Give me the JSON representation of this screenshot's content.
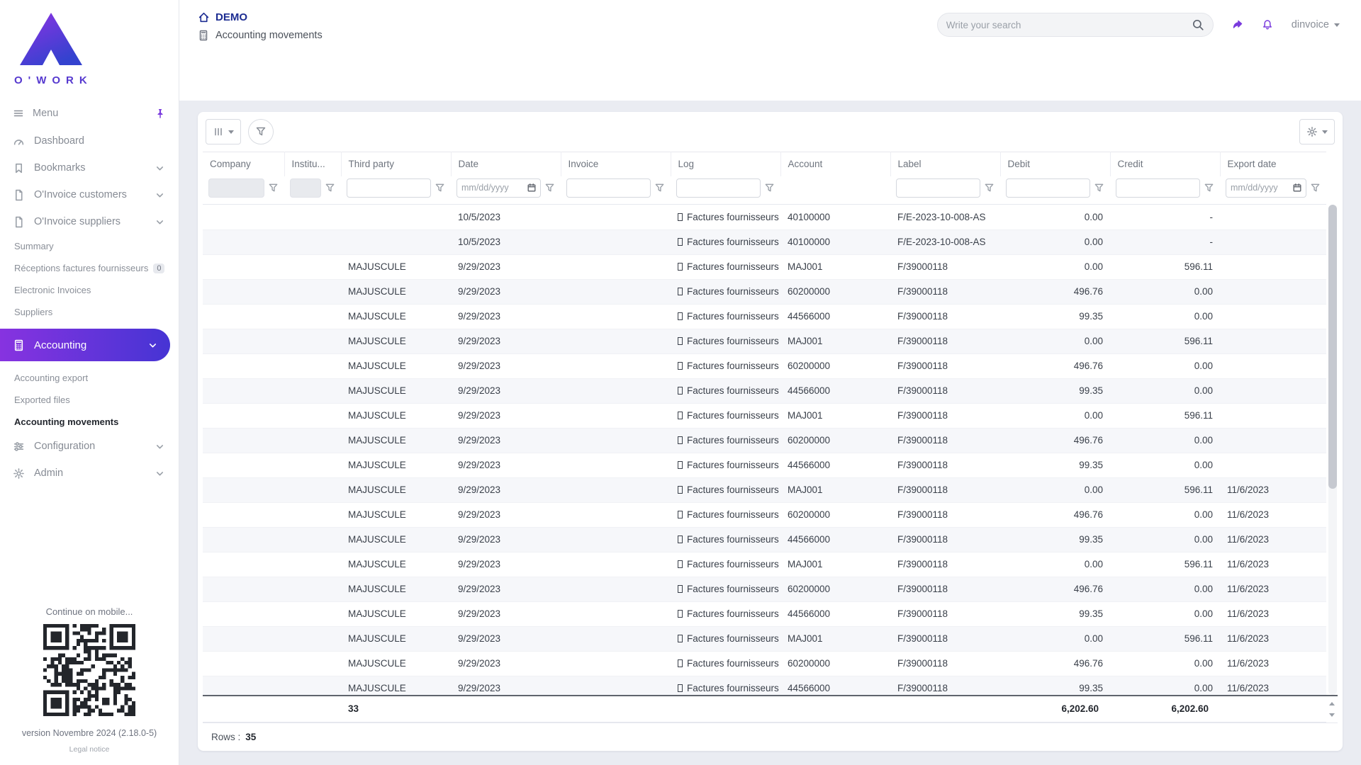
{
  "brand": {
    "wordmark": "O'WORK",
    "mobile_hint": "Continue on mobile...",
    "version": "version Novembre 2024 (2.18.0-5)",
    "legal_notice": "Legal notice"
  },
  "colors": {
    "accent_gradient_from": "#8733e0",
    "accent_gradient_to": "#4634d4",
    "brand_navy": "#1d2d92",
    "icon_purple": "#7a3bdd"
  },
  "icons": {
    "menu": "hamburger",
    "pin": "pushpin",
    "dashboard": "gauge",
    "bookmarks": "bookmark",
    "invoice": "file-document",
    "accounting": "calculator",
    "configuration": "sliders",
    "admin": "gear",
    "home": "house",
    "search": "magnifier",
    "share": "forward-arrow",
    "notifications": "bell",
    "filter": "funnel",
    "date": "calendar",
    "columns": "triple-bar",
    "settings": "gear",
    "log_prefix": "missing-glyph-box"
  },
  "header": {
    "env_label": "DEMO",
    "page_title": "Accounting movements",
    "search": {
      "placeholder": "Write your search"
    },
    "user_menu": {
      "label": "dinvoice"
    }
  },
  "sidebar": {
    "menu_label": "Menu",
    "items": {
      "dashboard": "Dashboard",
      "bookmarks": "Bookmarks",
      "oinvoice_customers": "O'Invoice customers",
      "oinvoice_suppliers": "O'Invoice suppliers",
      "summary": "Summary",
      "receptions": "Réceptions factures fournisseurs",
      "receptions_badge": "0",
      "electronic_invoices": "Electronic Invoices",
      "suppliers": "Suppliers",
      "accounting": "Accounting",
      "accounting_export": "Accounting export",
      "exported_files": "Exported files",
      "accounting_movements": "Accounting movements",
      "configuration": "Configuration",
      "admin": "Admin"
    }
  },
  "table": {
    "columns": [
      "Company",
      "Institu...",
      "Third party",
      "Date",
      "Invoice",
      "Log",
      "Account",
      "Label",
      "Debit",
      "Credit",
      "Export date"
    ],
    "filters": {
      "date_placeholder": "mm/dd/yyyy",
      "export_placeholder": "mm/dd/yyyy"
    },
    "rows": [
      {
        "company": "",
        "institution": "",
        "third_party": "",
        "date": "10/5/2023",
        "invoice": "",
        "log": "Factures fournisseurs",
        "account": "40100000",
        "label": "F/E-2023-10-008-AS",
        "debit": "0.00",
        "credit": "-",
        "export_date": ""
      },
      {
        "company": "",
        "institution": "",
        "third_party": "",
        "date": "10/5/2023",
        "invoice": "",
        "log": "Factures fournisseurs",
        "account": "40100000",
        "label": "F/E-2023-10-008-AS",
        "debit": "0.00",
        "credit": "-",
        "export_date": ""
      },
      {
        "company": "",
        "institution": "",
        "third_party": "MAJUSCULE",
        "date": "9/29/2023",
        "invoice": "",
        "log": "Factures fournisseurs",
        "account": "MAJ001",
        "label": "F/39000118",
        "debit": "0.00",
        "credit": "596.11",
        "export_date": ""
      },
      {
        "company": "",
        "institution": "",
        "third_party": "MAJUSCULE",
        "date": "9/29/2023",
        "invoice": "",
        "log": "Factures fournisseurs",
        "account": "60200000",
        "label": "F/39000118",
        "debit": "496.76",
        "credit": "0.00",
        "export_date": ""
      },
      {
        "company": "",
        "institution": "",
        "third_party": "MAJUSCULE",
        "date": "9/29/2023",
        "invoice": "",
        "log": "Factures fournisseurs",
        "account": "44566000",
        "label": "F/39000118",
        "debit": "99.35",
        "credit": "0.00",
        "export_date": ""
      },
      {
        "company": "",
        "institution": "",
        "third_party": "MAJUSCULE",
        "date": "9/29/2023",
        "invoice": "",
        "log": "Factures fournisseurs",
        "account": "MAJ001",
        "label": "F/39000118",
        "debit": "0.00",
        "credit": "596.11",
        "export_date": ""
      },
      {
        "company": "",
        "institution": "",
        "third_party": "MAJUSCULE",
        "date": "9/29/2023",
        "invoice": "",
        "log": "Factures fournisseurs",
        "account": "60200000",
        "label": "F/39000118",
        "debit": "496.76",
        "credit": "0.00",
        "export_date": ""
      },
      {
        "company": "",
        "institution": "",
        "third_party": "MAJUSCULE",
        "date": "9/29/2023",
        "invoice": "",
        "log": "Factures fournisseurs",
        "account": "44566000",
        "label": "F/39000118",
        "debit": "99.35",
        "credit": "0.00",
        "export_date": ""
      },
      {
        "company": "",
        "institution": "",
        "third_party": "MAJUSCULE",
        "date": "9/29/2023",
        "invoice": "",
        "log": "Factures fournisseurs",
        "account": "MAJ001",
        "label": "F/39000118",
        "debit": "0.00",
        "credit": "596.11",
        "export_date": ""
      },
      {
        "company": "",
        "institution": "",
        "third_party": "MAJUSCULE",
        "date": "9/29/2023",
        "invoice": "",
        "log": "Factures fournisseurs",
        "account": "60200000",
        "label": "F/39000118",
        "debit": "496.76",
        "credit": "0.00",
        "export_date": ""
      },
      {
        "company": "",
        "institution": "",
        "third_party": "MAJUSCULE",
        "date": "9/29/2023",
        "invoice": "",
        "log": "Factures fournisseurs",
        "account": "44566000",
        "label": "F/39000118",
        "debit": "99.35",
        "credit": "0.00",
        "export_date": ""
      },
      {
        "company": "",
        "institution": "",
        "third_party": "MAJUSCULE",
        "date": "9/29/2023",
        "invoice": "",
        "log": "Factures fournisseurs",
        "account": "MAJ001",
        "label": "F/39000118",
        "debit": "0.00",
        "credit": "596.11",
        "export_date": "11/6/2023"
      },
      {
        "company": "",
        "institution": "",
        "third_party": "MAJUSCULE",
        "date": "9/29/2023",
        "invoice": "",
        "log": "Factures fournisseurs",
        "account": "60200000",
        "label": "F/39000118",
        "debit": "496.76",
        "credit": "0.00",
        "export_date": "11/6/2023"
      },
      {
        "company": "",
        "institution": "",
        "third_party": "MAJUSCULE",
        "date": "9/29/2023",
        "invoice": "",
        "log": "Factures fournisseurs",
        "account": "44566000",
        "label": "F/39000118",
        "debit": "99.35",
        "credit": "0.00",
        "export_date": "11/6/2023"
      },
      {
        "company": "",
        "institution": "",
        "third_party": "MAJUSCULE",
        "date": "9/29/2023",
        "invoice": "",
        "log": "Factures fournisseurs",
        "account": "MAJ001",
        "label": "F/39000118",
        "debit": "0.00",
        "credit": "596.11",
        "export_date": "11/6/2023"
      },
      {
        "company": "",
        "institution": "",
        "third_party": "MAJUSCULE",
        "date": "9/29/2023",
        "invoice": "",
        "log": "Factures fournisseurs",
        "account": "60200000",
        "label": "F/39000118",
        "debit": "496.76",
        "credit": "0.00",
        "export_date": "11/6/2023"
      },
      {
        "company": "",
        "institution": "",
        "third_party": "MAJUSCULE",
        "date": "9/29/2023",
        "invoice": "",
        "log": "Factures fournisseurs",
        "account": "44566000",
        "label": "F/39000118",
        "debit": "99.35",
        "credit": "0.00",
        "export_date": "11/6/2023"
      },
      {
        "company": "",
        "institution": "",
        "third_party": "MAJUSCULE",
        "date": "9/29/2023",
        "invoice": "",
        "log": "Factures fournisseurs",
        "account": "MAJ001",
        "label": "F/39000118",
        "debit": "0.00",
        "credit": "596.11",
        "export_date": "11/6/2023"
      },
      {
        "company": "",
        "institution": "",
        "third_party": "MAJUSCULE",
        "date": "9/29/2023",
        "invoice": "",
        "log": "Factures fournisseurs",
        "account": "60200000",
        "label": "F/39000118",
        "debit": "496.76",
        "credit": "0.00",
        "export_date": "11/6/2023"
      },
      {
        "company": "",
        "institution": "",
        "third_party": "MAJUSCULE",
        "date": "9/29/2023",
        "invoice": "",
        "log": "Factures fournisseurs",
        "account": "44566000",
        "label": "F/39000118",
        "debit": "99.35",
        "credit": "0.00",
        "export_date": "11/6/2023"
      }
    ],
    "totals": {
      "count": "33",
      "debit": "6,202.60",
      "credit": "6,202.60"
    },
    "footer": {
      "rows_label": "Rows :",
      "rows_value": "35"
    }
  }
}
